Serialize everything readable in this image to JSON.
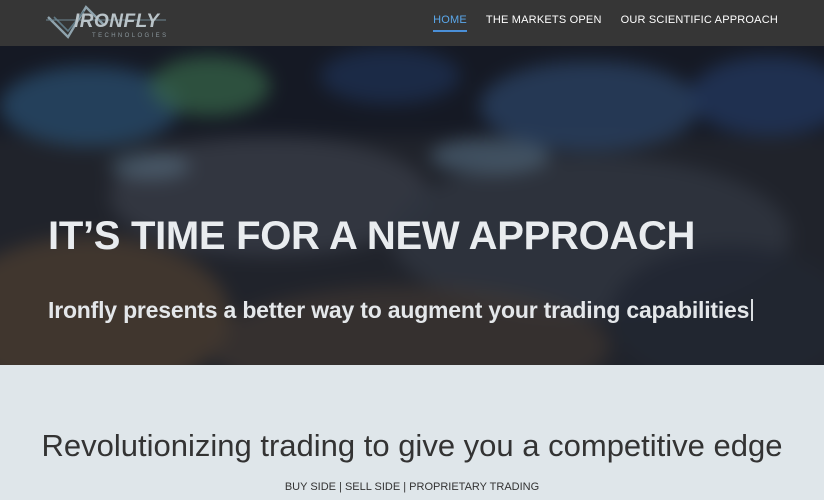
{
  "brand": {
    "name": "IRONFLY",
    "tagline": "TECHNOLOGIES"
  },
  "nav": {
    "items": [
      {
        "label": "HOME",
        "active": true
      },
      {
        "label": "THE MARKETS OPEN",
        "active": false
      },
      {
        "label": "OUR SCIENTIFIC APPROACH",
        "active": false
      }
    ]
  },
  "hero": {
    "title": "IT’S TIME FOR A NEW APPROACH",
    "subtitle": "Ironfly presents a better way to augment your trading capabilities"
  },
  "section": {
    "heading": "Revolutionizing trading to give you a competitive edge",
    "tags": "BUY SIDE | SELL SIDE | PROPRIETARY TRADING"
  },
  "colors": {
    "navbar": "#363636",
    "active_nav": "#5aa7ea",
    "section_bg": "#dfe6ea",
    "text_dark": "#333333"
  }
}
